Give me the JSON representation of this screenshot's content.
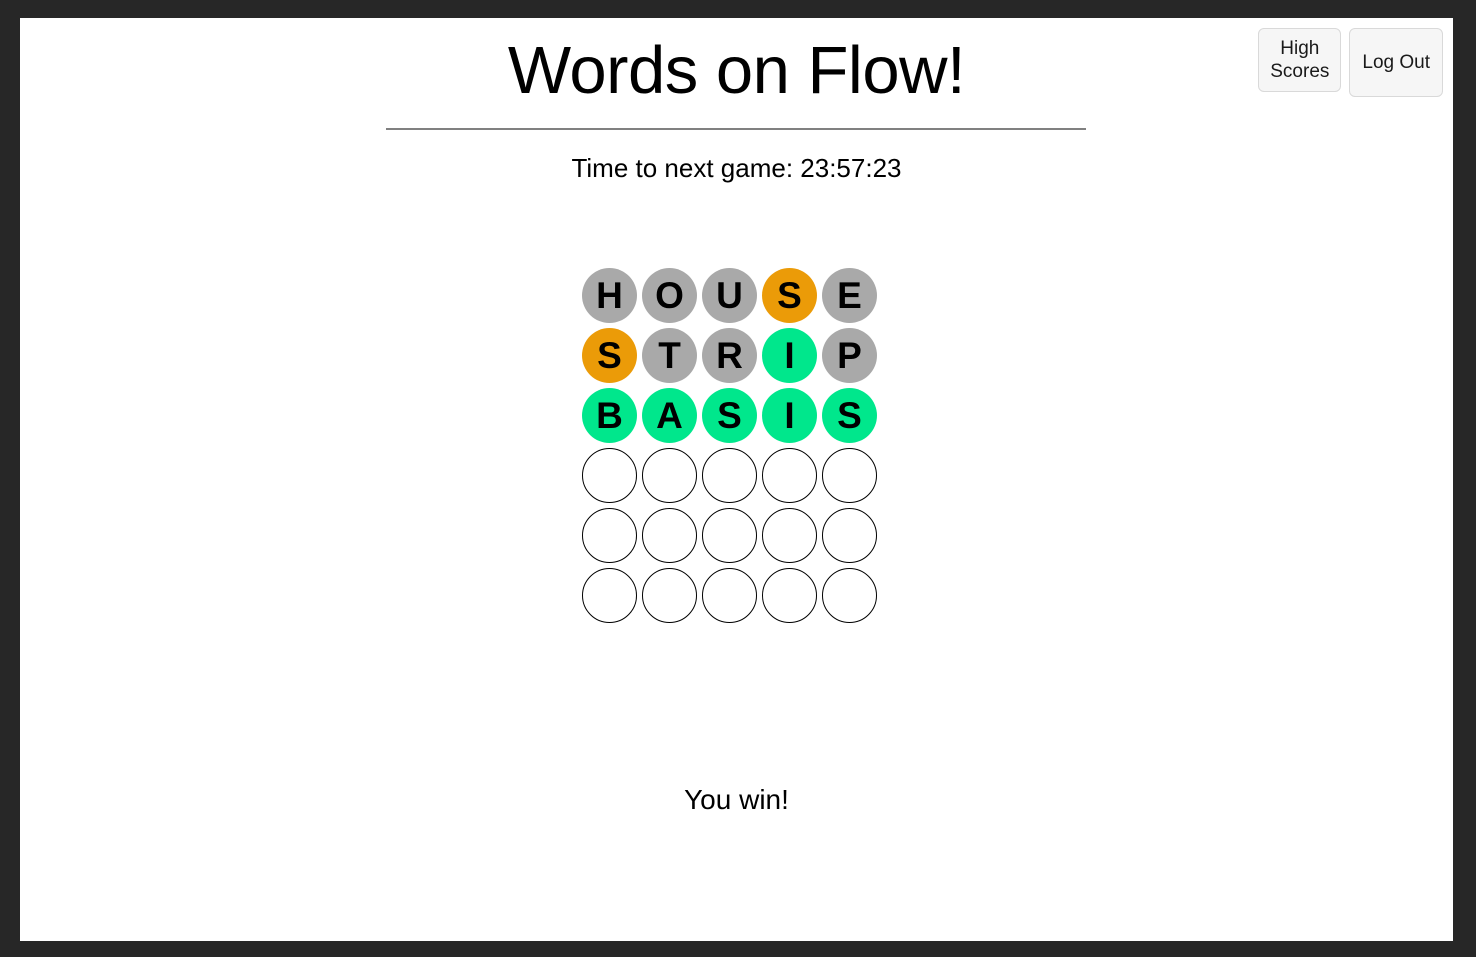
{
  "header": {
    "title": "Words on Flow!",
    "buttons": [
      {
        "name": "high-scores",
        "label": "High\nScores"
      },
      {
        "name": "log-out",
        "label": "Log Out"
      }
    ]
  },
  "status": {
    "timer_label": "Time to next game: 23:57:23"
  },
  "colors": {
    "correct": "#00e78c",
    "present": "#eb9b08",
    "absent": "#a9a9a9",
    "empty": "#ffffff",
    "page_background": "#ffffff",
    "frame": "#272727"
  },
  "board": {
    "rows": 6,
    "columns": 5,
    "guesses": [
      {
        "word": "HOUSE",
        "tiles": [
          {
            "letter": "H",
            "state": "absent"
          },
          {
            "letter": "O",
            "state": "absent"
          },
          {
            "letter": "U",
            "state": "absent"
          },
          {
            "letter": "S",
            "state": "present"
          },
          {
            "letter": "E",
            "state": "absent"
          }
        ]
      },
      {
        "word": "STRIP",
        "tiles": [
          {
            "letter": "S",
            "state": "present"
          },
          {
            "letter": "T",
            "state": "absent"
          },
          {
            "letter": "R",
            "state": "absent"
          },
          {
            "letter": "I",
            "state": "correct"
          },
          {
            "letter": "P",
            "state": "absent"
          }
        ]
      },
      {
        "word": "BASIS",
        "tiles": [
          {
            "letter": "B",
            "state": "correct"
          },
          {
            "letter": "A",
            "state": "correct"
          },
          {
            "letter": "S",
            "state": "correct"
          },
          {
            "letter": "I",
            "state": "correct"
          },
          {
            "letter": "S",
            "state": "correct"
          }
        ]
      },
      {
        "word": "",
        "tiles": [
          {
            "letter": "",
            "state": "empty"
          },
          {
            "letter": "",
            "state": "empty"
          },
          {
            "letter": "",
            "state": "empty"
          },
          {
            "letter": "",
            "state": "empty"
          },
          {
            "letter": "",
            "state": "empty"
          }
        ]
      },
      {
        "word": "",
        "tiles": [
          {
            "letter": "",
            "state": "empty"
          },
          {
            "letter": "",
            "state": "empty"
          },
          {
            "letter": "",
            "state": "empty"
          },
          {
            "letter": "",
            "state": "empty"
          },
          {
            "letter": "",
            "state": "empty"
          }
        ]
      },
      {
        "word": "",
        "tiles": [
          {
            "letter": "",
            "state": "empty"
          },
          {
            "letter": "",
            "state": "empty"
          },
          {
            "letter": "",
            "state": "empty"
          },
          {
            "letter": "",
            "state": "empty"
          },
          {
            "letter": "",
            "state": "empty"
          }
        ]
      }
    ]
  },
  "result": {
    "message": "You win!"
  }
}
